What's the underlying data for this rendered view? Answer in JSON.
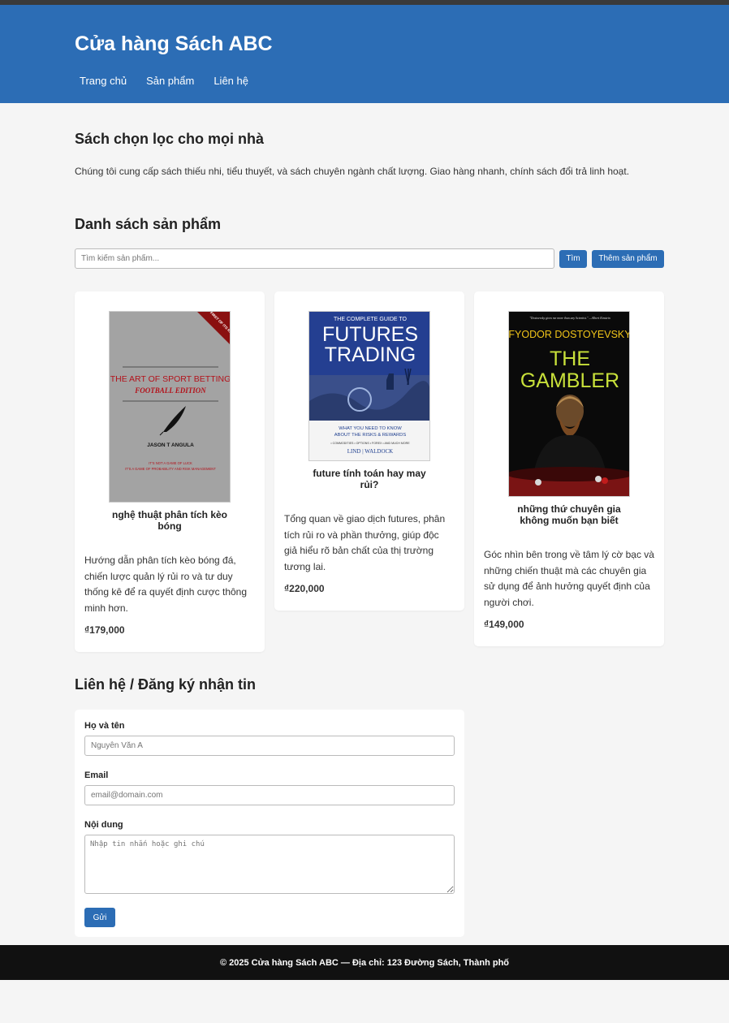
{
  "site": {
    "title": "Cửa hàng Sách ABC",
    "nav": [
      "Trang chủ",
      "Sản phẩm",
      "Liên hệ"
    ]
  },
  "intro": {
    "heading": "Sách chọn lọc cho mọi nhà",
    "text": "Chúng tôi cung cấp sách thiếu nhi, tiểu thuyết, và sách chuyên ngành chất lượng. Giao hàng nhanh, chính sách đổi trả linh hoạt."
  },
  "products": {
    "heading": "Danh sách sản phẩm",
    "search_placeholder": "Tìm kiếm sản phẩm...",
    "search_button": "Tìm",
    "add_button": "Thêm sản phẩm",
    "items": [
      {
        "name": "nghệ thuật phân tích kèo bóng",
        "description": "Hướng dẫn phân tích kèo bóng đá, chiến lược quản lý rủi ro và tư duy thống kê để ra quyết định cược thông minh hơn.",
        "price": "₫179,000",
        "cover": {
          "corner": "FIRST OF ITS KIND",
          "title": "THE ART OF SPORT BETTING",
          "subtitle": "FOOTBALL EDITION",
          "author": "JASON T ANGULA",
          "tagline1": "IT'S NOT A GAME OF LUCK",
          "tagline2": "IT'S A GAME OF PROBABILITY AND RISK MANAGEMENT"
        }
      },
      {
        "name": "future tính toán hay may rủi?",
        "description": "Tổng quan về giao dịch futures, phân tích rủi ro và phần thưởng, giúp độc giả hiểu rõ bản chất của thị trường tương lai.",
        "price": "₫220,000",
        "cover": {
          "top": "THE COMPLETE GUIDE TO",
          "title1": "FUTURES",
          "title2": "TRADING",
          "sub1": "WHAT YOU NEED TO KNOW",
          "sub2": "ABOUT THE RISKS & REWARDS",
          "topics": "• COMMODITIES • OPTIONS • FOREX • AND MUCH MORE",
          "author": "LIND | WALDOCK"
        }
      },
      {
        "name": "những thứ chuyên gia không muốn bạn biết",
        "description": "Góc nhìn bên trong về tâm lý cờ bạc và những chiến thuật mà các chuyên gia sử dụng để ảnh hưởng quyết định của người chơi.",
        "price": "₫149,000",
        "cover": {
          "quote": "\"Dostoevsky gives me more than any Scientist.\" —Albert Einstein",
          "author": "FYODOR DOSTOYEVSKY",
          "title1": "THE",
          "title2": "GAMBLER"
        }
      }
    ]
  },
  "contact": {
    "heading": "Liên hệ / Đăng ký nhận tin",
    "name_label": "Họ và tên",
    "name_placeholder": "Nguyễn Văn A",
    "email_label": "Email",
    "email_placeholder": "email@domain.com",
    "message_label": "Nội dung",
    "message_placeholder": "Nhập tin nhắn hoặc ghi chú",
    "submit": "Gửi"
  },
  "footer": {
    "text": "© 2025 Cửa hàng Sách ABC — Địa chỉ: 123 Đường Sách, Thành phố"
  },
  "colors": {
    "brand": "#2c6db5",
    "footer_bg": "#111111",
    "page_bg": "#f5f5f5"
  }
}
